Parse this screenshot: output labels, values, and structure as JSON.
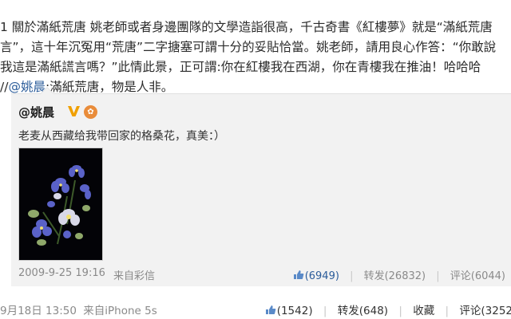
{
  "post": {
    "lines": [
      "1 關於滿紙荒唐 姚老師或者身邊團隊的文學造詣很高，千古奇書《紅樓夢》就是“滿紙荒唐",
      "言”，這十年沉冤用“荒唐”二字搪塞可謂十分的妥貼恰當。姚老師，請用良心作答：“你敢說",
      "我這是滿紙謊言嗎？”此情此景，正可謂:你在紅樓我在西湖，你在青樓我在推油！哈哈哈",
      "//",
      "@姚晨",
      ":滿紙荒唐，物是人非。"
    ]
  },
  "quote": {
    "author": "@姚晨",
    "verified_icon": "verified-v-icon",
    "award_icon": "award-badge-icon",
    "text": "老麦从西藏给我带回家的格桑花，真美：）",
    "photo_icon": "flower-photo",
    "time": "2009-9-25 19:16",
    "source": "来自彩信",
    "likes": "(6949)",
    "reposts": "转发(26832)",
    "comments": "评论(6044)",
    "sep": "|"
  },
  "bottom": {
    "time": "9月18日 13:50",
    "source": "来自iPhone 5s",
    "likes": "(1542)",
    "reposts": "转发(648)",
    "favorite": "收藏",
    "comments": "评论(3252",
    "sep": "|"
  },
  "colors": {
    "link": "#2b5c9a",
    "verified": "#f0a000",
    "quote_bg": "#f2f2f2"
  }
}
